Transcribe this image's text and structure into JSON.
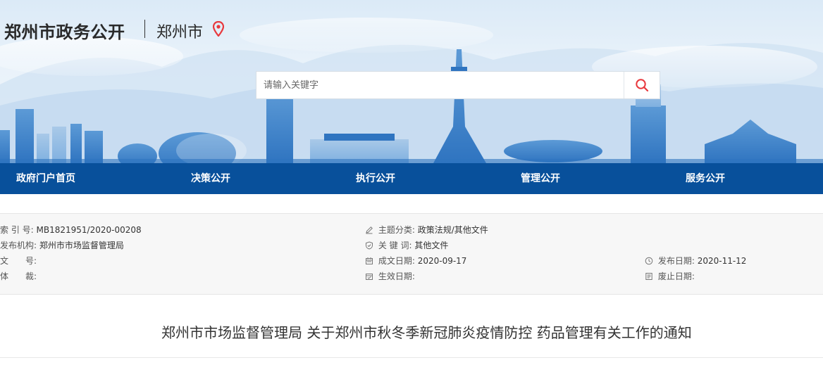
{
  "header": {
    "site_title": "郑州市政务公开",
    "city": "郑州市",
    "location_icon": "location-pin-icon",
    "accent_color": "#e8383d"
  },
  "search": {
    "placeholder": "请输入关键字",
    "value": "",
    "icon": "search-icon"
  },
  "nav": {
    "background": "#08509b",
    "items": [
      {
        "label": "政府门户首页"
      },
      {
        "label": "决策公开"
      },
      {
        "label": "执行公开"
      },
      {
        "label": "管理公开"
      },
      {
        "label": "服务公开"
      }
    ]
  },
  "info": {
    "index_no": {
      "label": "索 引 号:",
      "value": "MB1821951/2020-00208"
    },
    "publisher": {
      "label": "发布机构:",
      "value": "郑州市市场监督管理局"
    },
    "doc_no": {
      "label": "文　　号:",
      "value": ""
    },
    "body": {
      "label": "体　　裁:",
      "value": ""
    },
    "topic": {
      "label": "主题分类:",
      "value": "政策法规/其他文件",
      "icon": "edit-icon"
    },
    "keywords": {
      "label": "关 键 词:",
      "value": "其他文件",
      "icon": "shield-icon"
    },
    "created": {
      "label": "成文日期:",
      "value": "2020-09-17",
      "icon": "calendar-icon"
    },
    "effective": {
      "label": "生效日期:",
      "value": "",
      "icon": "calendar-check-icon"
    },
    "published": {
      "label": "发布日期:",
      "value": "2020-11-12",
      "icon": "clock-icon"
    },
    "expire": {
      "label": "废止日期:",
      "value": "",
      "icon": "document-icon"
    }
  },
  "document": {
    "title": "郑州市市场监督管理局 关于郑州市秋冬季新冠肺炎疫情防控 药品管理有关工作的通知"
  }
}
